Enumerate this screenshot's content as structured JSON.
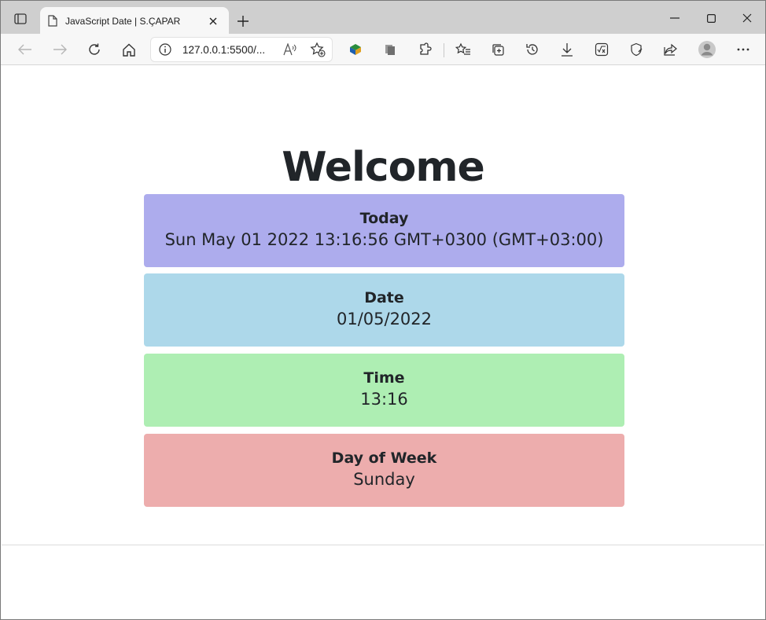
{
  "browser": {
    "tab_title": "JavaScript Date | S.ÇAPAR",
    "url": "127.0.0.1:5500/...",
    "icons": [
      "tab-actions-icon",
      "page-icon",
      "close-icon",
      "new-tab-icon",
      "minimize-icon",
      "maximize-icon",
      "window-close-icon",
      "back-icon",
      "forward-icon",
      "refresh-icon",
      "home-icon",
      "info-icon",
      "read-aloud-icon",
      "add-favorite-icon",
      "extension-1-icon",
      "extension-2-icon",
      "extensions-icon",
      "favorites-icon",
      "collections-icon",
      "history-icon",
      "downloads-icon",
      "math-solver-icon",
      "browser-essentials-icon",
      "share-icon",
      "profile-icon",
      "more-icon"
    ]
  },
  "page": {
    "heading": "Welcome",
    "cards": [
      {
        "label": "Today",
        "value": "Sun May 01 2022 13:16:56 GMT+0300 (GMT+03:00)",
        "color": "#adaced"
      },
      {
        "label": "Date",
        "value": "01/05/2022",
        "color": "#add8ea"
      },
      {
        "label": "Time",
        "value": "13:16",
        "color": "#aeeeb3"
      },
      {
        "label": "Day of Week",
        "value": "Sunday",
        "color": "#edadad"
      }
    ]
  }
}
